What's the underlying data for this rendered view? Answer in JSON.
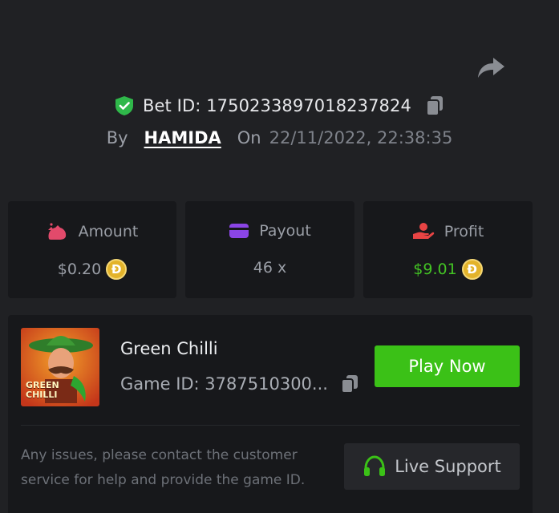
{
  "header": {
    "share_icon": "share-arrow-icon",
    "verified_icon": "shield-check-icon",
    "bet_id_label": "Bet ID:",
    "bet_id": "1750233897018237824",
    "copy_icon": "copy-icon",
    "by_label": "By",
    "username": "HAMIDA",
    "on_label": "On",
    "datetime": "22/11/2022, 22:38:35"
  },
  "stats": {
    "amount": {
      "label": "Amount",
      "value": "$0.20",
      "icon": "money-bag-icon",
      "coin": "Ð"
    },
    "payout": {
      "label": "Payout",
      "value": "46 x",
      "icon": "wallet-card-icon"
    },
    "profit": {
      "label": "Profit",
      "value": "$9.01",
      "icon": "hand-profit-icon",
      "coin": "Ð"
    }
  },
  "game": {
    "name": "Green Chilli",
    "id_text": "Game ID: 3787510300...",
    "thumb_title_line1": "GREEN",
    "thumb_title_line2": "CHILLI",
    "play_label": "Play Now",
    "issues_text": "Any issues, please contact the customer service for help and provide the game ID.",
    "support_label": "Live Support",
    "support_icon": "headset-icon"
  },
  "colors": {
    "background": "#202124",
    "card": "#17181b",
    "accent_green": "#3bc117",
    "profit_green": "#43c324",
    "coin_gold": "#e3b32a",
    "amount_icon": "#e24a6b",
    "payout_icon": "#8b45e6",
    "profit_icon": "#e84444"
  }
}
